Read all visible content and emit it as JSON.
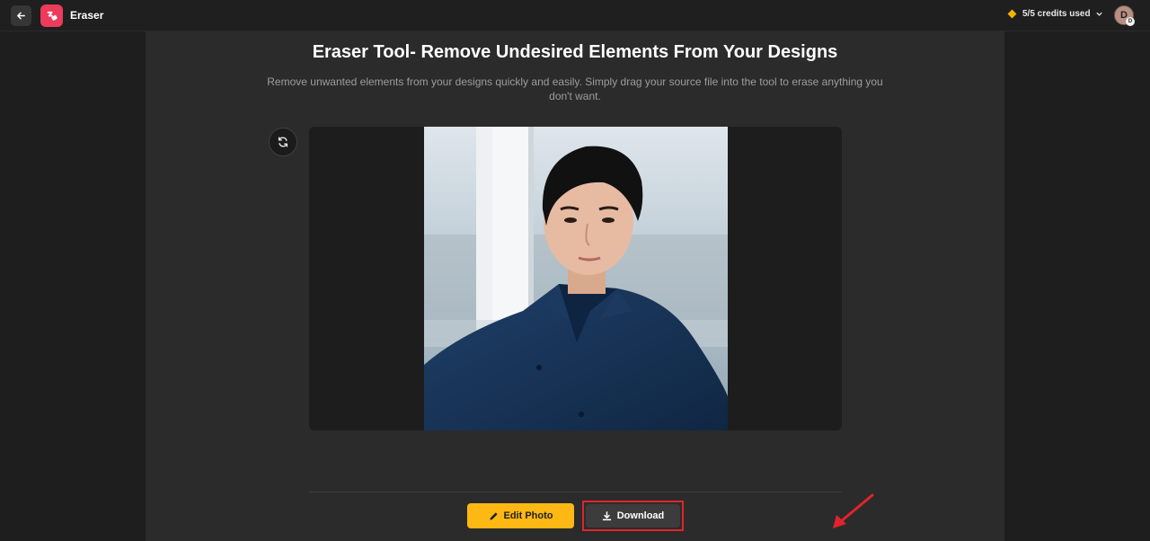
{
  "header": {
    "app_title": "Eraser",
    "credits_text": "5/5 credits used",
    "avatar_initial": "D",
    "avatar_badge": "D"
  },
  "main": {
    "title": "Eraser Tool- Remove Undesired Elements From Your Designs",
    "subtitle": "Remove unwanted elements from your designs quickly and easily. Simply drag your source file into the tool to erase anything you don't want."
  },
  "actions": {
    "edit_label": "Edit Photo",
    "download_label": "Download"
  },
  "icons": [
    "back-arrow-icon",
    "app-logo-icon",
    "diamond-icon",
    "chevron-down-icon",
    "refresh-icon",
    "pencil-icon",
    "download-icon",
    "red-arrow-annotation"
  ],
  "colors": {
    "accent_yellow": "#fdb813",
    "brand_pink": "#ec3b5b",
    "annotation_red": "#e0242c"
  }
}
